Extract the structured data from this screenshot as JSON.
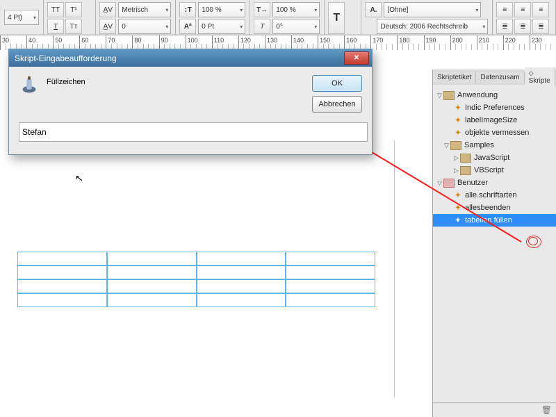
{
  "toolbar": {
    "pt_label": "4 Pt)",
    "units_sel": "Metrisch",
    "scale_h": "100 %",
    "scale_v": "100 %",
    "baseline": "0 Pt",
    "skew": "0°",
    "charstyle": "[Ohne]",
    "lang": "Deutsch: 2006 Rechtschreib"
  },
  "ruler": {
    "start": 30,
    "step": 10,
    "count": 21
  },
  "dialog": {
    "title": "Skript-Eingabeaufforderung",
    "label": "Füllzeichen",
    "ok": "OK",
    "cancel": "Abbrechen",
    "input_value": "Stefan"
  },
  "panel": {
    "tabs": [
      "Skriptetiket",
      "Datenzusam",
      "Skripte"
    ],
    "active_tab": 2,
    "tree": {
      "anwendung": "Anwendung",
      "indic": "Indic Preferences",
      "labelimg": "labelImageSize",
      "objekte": "objekte vermessen",
      "samples": "Samples",
      "js": "JavaScript",
      "vb": "VBScript",
      "benutzer": "Benutzer",
      "alleschrift": "alle.schriftarten",
      "allesbeenden": "allesbeenden",
      "tabellen": "tabellen füllen"
    }
  }
}
